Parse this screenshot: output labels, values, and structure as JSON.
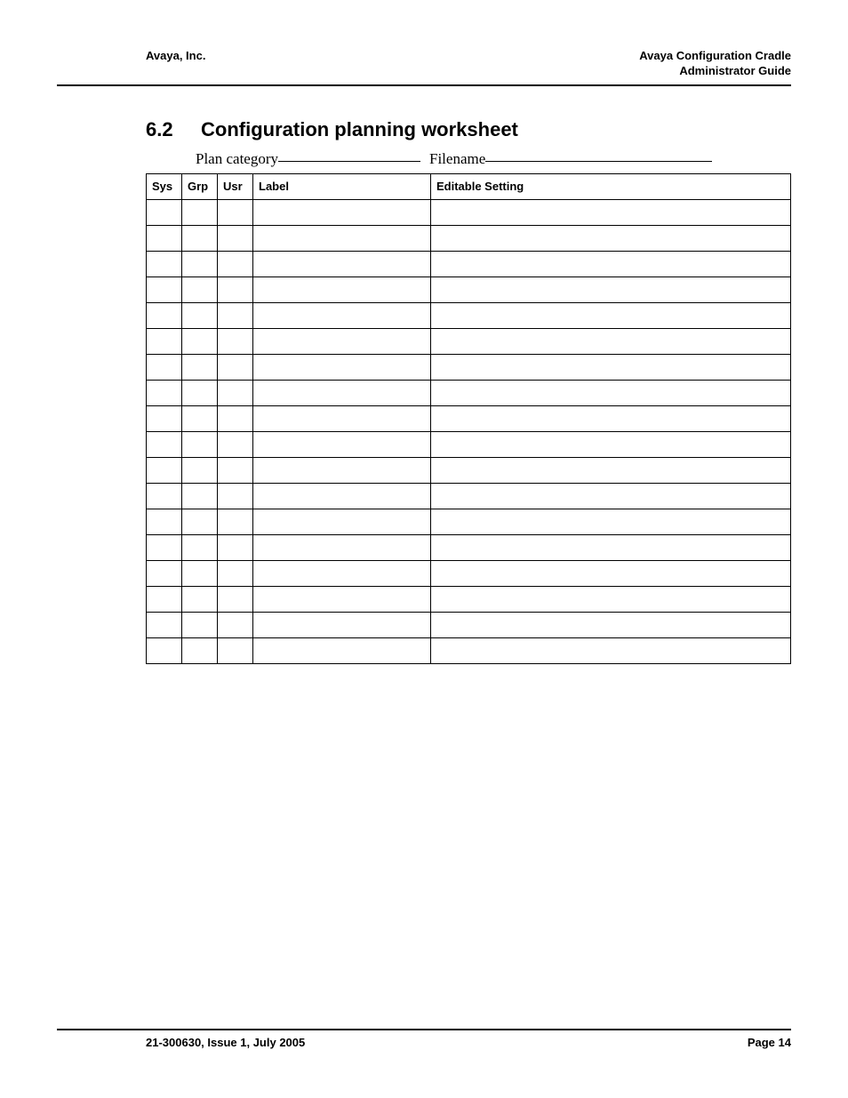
{
  "header": {
    "left": "Avaya, Inc.",
    "right_line1": "Avaya Configuration Cradle",
    "right_line2": "Administrator Guide"
  },
  "section": {
    "number": "6.2",
    "title": "Configuration planning worksheet"
  },
  "fill": {
    "plan_label": "Plan category",
    "filename_label": "Filename"
  },
  "table": {
    "headers": {
      "sys": "Sys",
      "grp": "Grp",
      "usr": "Usr",
      "label": "Label",
      "editable": "Editable Setting"
    },
    "rows": 18
  },
  "footer": {
    "left": "21-300630, Issue 1, July 2005",
    "right": "Page 14"
  }
}
